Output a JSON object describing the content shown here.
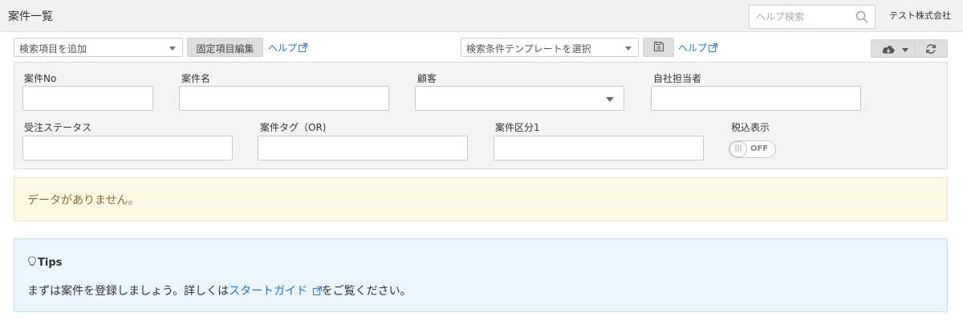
{
  "header": {
    "title": "案件一覧",
    "help_search_placeholder": "ヘルプ検索",
    "company": "テスト株式会社"
  },
  "toolbar": {
    "add_search_item": "検索項目を追加",
    "fixed_item_edit": "固定項目編集",
    "help_left": "ヘルプ",
    "template_select": "検索条件テンプレートを選択",
    "help_right": "ヘルプ"
  },
  "filters": {
    "case_no_label": "案件No",
    "case_name_label": "案件名",
    "customer_label": "顧客",
    "owner_label": "自社担当者",
    "order_status_label": "受注ステータス",
    "case_tag_label": "案件タグ（OR)",
    "case_category_label": "案件区分1",
    "tax_label": "税込表示",
    "tax_toggle_state": "OFF"
  },
  "alert": {
    "message": "データがありません。"
  },
  "tips": {
    "title": "Tips",
    "msg_before": "まずは案件を登録しましょう。詳しくは",
    "link": "スタートガイド",
    "msg_after": "をご覧ください。"
  },
  "icons": [
    "search-icon",
    "external-link-icon",
    "save-icon",
    "cloud-download-icon",
    "refresh-icon",
    "lightbulb-icon"
  ]
}
